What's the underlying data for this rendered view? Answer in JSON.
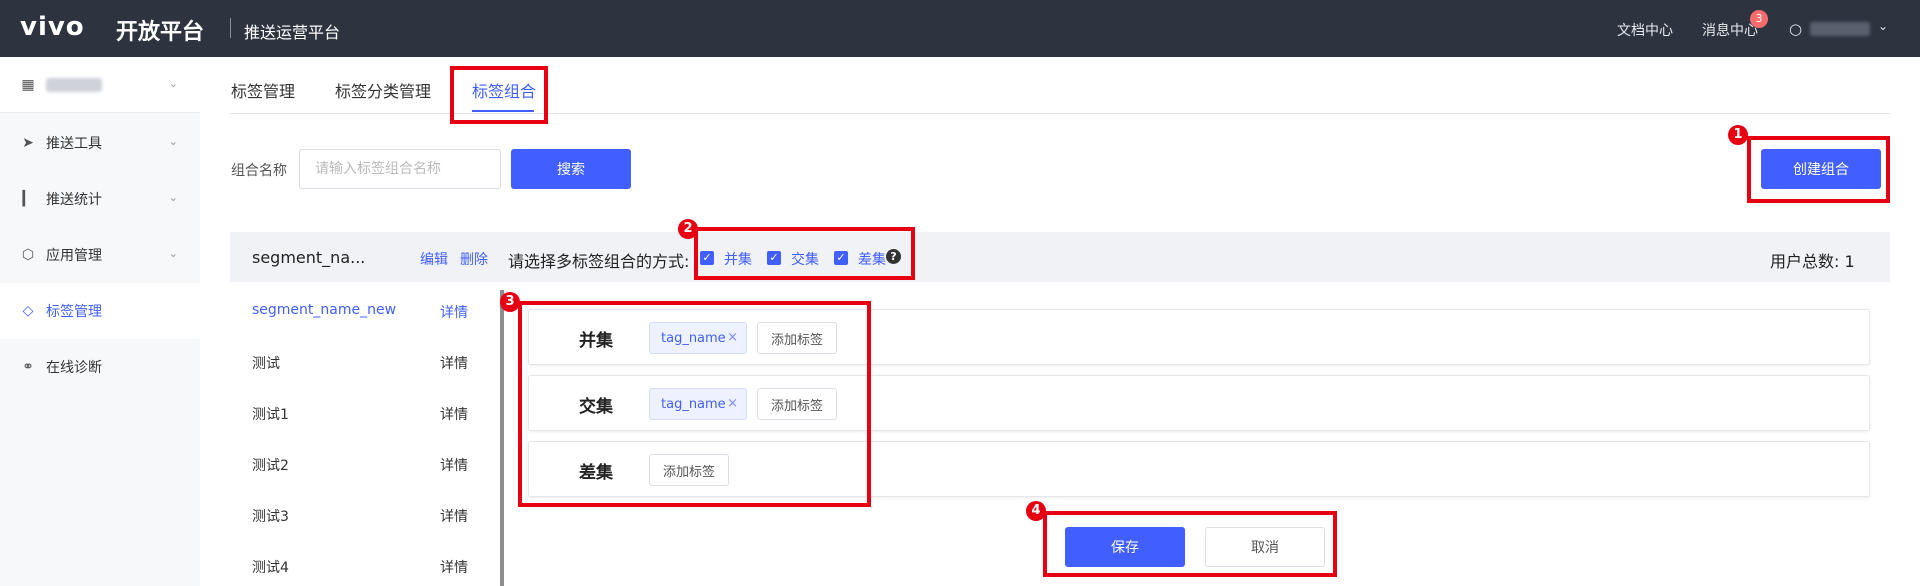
{
  "header": {
    "logo": "vivo",
    "logo_sub": "开放平台",
    "platform": "推送运营平台",
    "docs": "文档中心",
    "messages": "消息中心",
    "message_count": "3"
  },
  "sidebar": {
    "items": [
      {
        "label": "推送工具",
        "icon": "send-icon"
      },
      {
        "label": "推送统计",
        "icon": "bar-chart-icon"
      },
      {
        "label": "应用管理",
        "icon": "cube-icon"
      },
      {
        "label": "标签管理",
        "icon": "tag-icon"
      },
      {
        "label": "在线诊断",
        "icon": "stethoscope-icon"
      }
    ]
  },
  "tabs": [
    {
      "label": "标签管理"
    },
    {
      "label": "标签分类管理"
    },
    {
      "label": "标签组合"
    }
  ],
  "search": {
    "label": "组合名称",
    "placeholder": "请输入标签组合名称",
    "button": "搜索"
  },
  "create_button": "创建组合",
  "segment": {
    "title": "segment_na...",
    "edit": "编辑",
    "delete": "删除",
    "mode_label": "请选择多标签组合的方式:",
    "modes": [
      {
        "label": "并集",
        "checked": true
      },
      {
        "label": "交集",
        "checked": true
      },
      {
        "label": "差集",
        "checked": true
      }
    ],
    "help": "?",
    "user_total": "用户总数: 1"
  },
  "list": [
    {
      "name": "segment_name_new",
      "detail": "详情",
      "active": true
    },
    {
      "name": "测试",
      "detail": "详情"
    },
    {
      "name": "测试1",
      "detail": "详情"
    },
    {
      "name": "测试2",
      "detail": "详情"
    },
    {
      "name": "测试3",
      "detail": "详情"
    },
    {
      "name": "测试4",
      "detail": "详情"
    }
  ],
  "sets": [
    {
      "title": "并集",
      "tag": "tag_name",
      "remove": "×",
      "add": "添加标签"
    },
    {
      "title": "交集",
      "tag": "tag_name",
      "remove": "×",
      "add": "添加标签"
    },
    {
      "title": "差集",
      "add": "添加标签"
    }
  ],
  "actions": {
    "save": "保存",
    "cancel": "取消"
  },
  "annotations": [
    "1",
    "2",
    "3",
    "4"
  ],
  "colors": {
    "primary": "#415fff",
    "header_bg": "#2e3340",
    "annotation_red": "#e60012"
  }
}
